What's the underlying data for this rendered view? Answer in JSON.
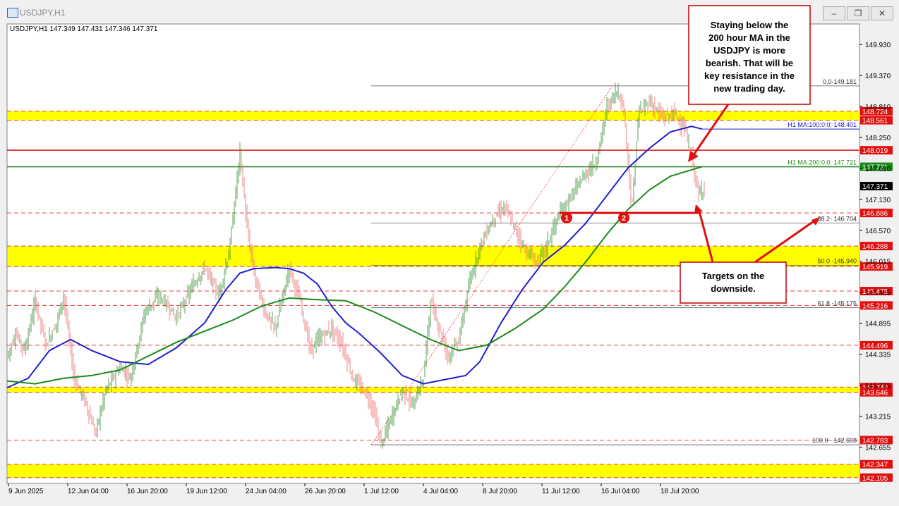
{
  "window": {
    "title": "USDJPY,H1",
    "buttons": {
      "minimize": "‒",
      "restore": "❐",
      "close": "✕"
    }
  },
  "chart_data": {
    "type": "candlestick",
    "symbol_header": "USDJPY,H1  147.349 147.431 147.346 147.371",
    "ylim": [
      142.0,
      150.3
    ],
    "y_ticks": [
      149.93,
      149.37,
      148.81,
      148.25,
      147.69,
      147.13,
      146.57,
      146.015,
      145.455,
      144.895,
      144.335,
      143.775,
      143.215,
      142.655
    ],
    "x_ticks": [
      "9 Jun 2025",
      "12 Jun 04:00",
      "16 Jun 20:00",
      "19 Jun 12:00",
      "24 Jun 04:00",
      "26 Jun 20:00",
      "1 Jul 12:00",
      "4 Jul 04:00",
      "8 Jul 20:00",
      "11 Jul 12:00",
      "16 Jul 04:00",
      "18 Jul 20:00"
    ],
    "yellow_zones": [
      [
        148.561,
        148.724
      ],
      [
        145.919,
        146.288
      ],
      [
        143.646,
        143.74
      ],
      [
        142.105,
        142.347
      ]
    ],
    "price_lines": [
      {
        "label": "148.724",
        "style": "dashed",
        "color": "#e83b3b"
      },
      {
        "label": "148.561",
        "style": "dashed",
        "color": "#e83b3b"
      },
      {
        "label": "148.019",
        "style": "solid",
        "color": "#e01010"
      },
      {
        "label": "147.721",
        "style": "solid",
        "color": "#2e8b2e"
      },
      {
        "label": "147.371",
        "style": "current",
        "color": "#000000"
      },
      {
        "label": "146.886",
        "style": "dashed",
        "color": "#e83b3b"
      },
      {
        "label": "146.288",
        "style": "dashed",
        "color": "#e83b3b"
      },
      {
        "label": "145.919",
        "style": "dashed",
        "color": "#e83b3b"
      },
      {
        "label": "145.475",
        "style": "dashed",
        "color": "#e83b3b"
      },
      {
        "label": "145.216",
        "style": "dashed",
        "color": "#e83b3b"
      },
      {
        "label": "144.496",
        "style": "dashed",
        "color": "#e83b3b"
      },
      {
        "label": "143.740",
        "style": "dashed",
        "color": "#e83b3b"
      },
      {
        "label": "143.646",
        "style": "dashed",
        "color": "#e83b3b"
      },
      {
        "label": "142.783",
        "style": "dashed",
        "color": "#e83b3b"
      },
      {
        "label": "142.347",
        "style": "dashed",
        "color": "#e83b3b"
      },
      {
        "label": "142.105",
        "style": "dashed",
        "color": "#e83b3b"
      }
    ],
    "fibonacci": [
      {
        "label": "0.0-149.181",
        "value": 149.181
      },
      {
        "label": "38.2- 146.704",
        "value": 146.704
      },
      {
        "label": "50.0 -145.940",
        "value": 145.94
      },
      {
        "label": "61.8 -145.175",
        "value": 145.175
      },
      {
        "label": "100.0 - 142.698",
        "value": 142.698
      }
    ],
    "ma_labels": {
      "ma100": "H1 MA:100:0:0: 148.401",
      "ma200": "H1 MA:200:0:0: 147.721"
    },
    "ma100_series": [
      [
        0,
        143.73
      ],
      [
        30,
        143.9
      ],
      [
        60,
        144.4
      ],
      [
        90,
        144.6
      ],
      [
        120,
        144.4
      ],
      [
        160,
        144.2
      ],
      [
        200,
        144.15
      ],
      [
        240,
        144.45
      ],
      [
        280,
        144.9
      ],
      [
        310,
        145.5
      ],
      [
        330,
        145.8
      ],
      [
        350,
        145.88
      ],
      [
        380,
        145.9
      ],
      [
        400,
        145.88
      ],
      [
        420,
        145.8
      ],
      [
        440,
        145.6
      ],
      [
        460,
        145.2
      ],
      [
        480,
        144.9
      ],
      [
        500,
        144.7
      ],
      [
        530,
        144.35
      ],
      [
        560,
        143.95
      ],
      [
        590,
        143.8
      ],
      [
        630,
        143.9
      ],
      [
        650,
        143.95
      ],
      [
        670,
        144.2
      ],
      [
        700,
        144.9
      ],
      [
        730,
        145.5
      ],
      [
        760,
        146.0
      ],
      [
        790,
        146.3
      ],
      [
        820,
        146.7
      ],
      [
        850,
        147.2
      ],
      [
        880,
        147.7
      ],
      [
        910,
        148.05
      ],
      [
        940,
        148.35
      ],
      [
        970,
        148.45
      ],
      [
        985,
        148.401
      ]
    ],
    "ma200_series": [
      [
        0,
        143.85
      ],
      [
        40,
        143.8
      ],
      [
        80,
        143.9
      ],
      [
        120,
        143.95
      ],
      [
        160,
        144.05
      ],
      [
        200,
        144.3
      ],
      [
        240,
        144.55
      ],
      [
        280,
        144.75
      ],
      [
        320,
        144.95
      ],
      [
        360,
        145.2
      ],
      [
        400,
        145.35
      ],
      [
        440,
        145.32
      ],
      [
        480,
        145.3
      ],
      [
        520,
        145.1
      ],
      [
        560,
        144.85
      ],
      [
        600,
        144.6
      ],
      [
        640,
        144.4
      ],
      [
        680,
        144.5
      ],
      [
        720,
        144.8
      ],
      [
        760,
        145.15
      ],
      [
        790,
        145.55
      ],
      [
        820,
        146.0
      ],
      [
        850,
        146.5
      ],
      [
        880,
        146.95
      ],
      [
        910,
        147.3
      ],
      [
        940,
        147.55
      ],
      [
        985,
        147.721
      ]
    ],
    "price_path": [
      [
        0,
        144.3
      ],
      [
        12,
        144.7
      ],
      [
        25,
        144.4
      ],
      [
        40,
        145.3
      ],
      [
        55,
        144.5
      ],
      [
        70,
        144.9
      ],
      [
        80,
        145.4
      ],
      [
        95,
        143.9
      ],
      [
        110,
        143.5
      ],
      [
        125,
        142.9
      ],
      [
        140,
        143.7
      ],
      [
        160,
        144.1
      ],
      [
        175,
        143.9
      ],
      [
        195,
        145.1
      ],
      [
        215,
        145.4
      ],
      [
        240,
        145.0
      ],
      [
        260,
        145.5
      ],
      [
        280,
        145.9
      ],
      [
        300,
        145.4
      ],
      [
        315,
        146.2
      ],
      [
        330,
        148.0
      ],
      [
        340,
        146.6
      ],
      [
        350,
        145.8
      ],
      [
        365,
        145.1
      ],
      [
        380,
        144.8
      ],
      [
        400,
        145.9
      ],
      [
        415,
        145.3
      ],
      [
        430,
        144.4
      ],
      [
        440,
        144.6
      ],
      [
        460,
        144.8
      ],
      [
        475,
        144.5
      ],
      [
        490,
        143.9
      ],
      [
        510,
        143.6
      ],
      [
        520,
        143.3
      ],
      [
        530,
        142.7
      ],
      [
        545,
        143.2
      ],
      [
        560,
        143.7
      ],
      [
        575,
        143.4
      ],
      [
        590,
        143.9
      ],
      [
        600,
        145.3
      ],
      [
        610,
        144.9
      ],
      [
        625,
        144.3
      ],
      [
        640,
        144.6
      ],
      [
        655,
        145.6
      ],
      [
        670,
        146.3
      ],
      [
        690,
        146.8
      ],
      [
        705,
        147.0
      ],
      [
        720,
        146.6
      ],
      [
        735,
        146.2
      ],
      [
        750,
        146.0
      ],
      [
        765,
        146.3
      ],
      [
        780,
        146.8
      ],
      [
        800,
        147.2
      ],
      [
        820,
        147.6
      ],
      [
        835,
        147.8
      ],
      [
        850,
        148.8
      ],
      [
        865,
        149.1
      ],
      [
        875,
        148.7
      ],
      [
        885,
        146.9
      ],
      [
        895,
        148.7
      ],
      [
        910,
        148.9
      ],
      [
        930,
        148.6
      ],
      [
        945,
        148.7
      ],
      [
        960,
        148.4
      ],
      [
        970,
        147.9
      ],
      [
        980,
        147.2
      ],
      [
        988,
        147.371
      ]
    ]
  },
  "annotations": {
    "top_box": "Staying below the 200 hour MA in the USDJPY is more bearish. That will be key resistance in the new trading day.",
    "bottom_box": "Targets on the downside.",
    "marker1": "1",
    "marker2": "2"
  },
  "colors": {
    "yellow": "#ffff00",
    "ma100": "#2020d0",
    "ma200": "#1a8a1a",
    "bull": "#2e8b2e",
    "bear": "#e86a6a",
    "red_line": "#e01010",
    "current_tag": "#000000"
  }
}
